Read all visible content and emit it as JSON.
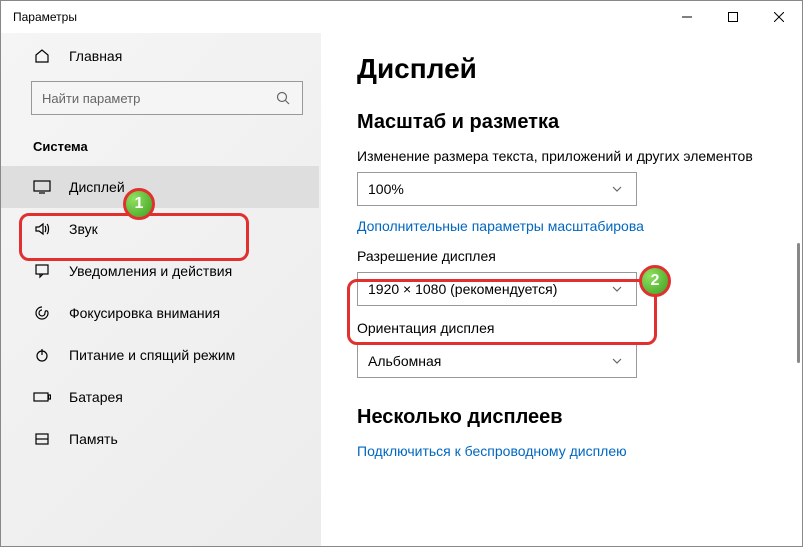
{
  "titlebar": {
    "title": "Параметры"
  },
  "sidebar": {
    "home": "Главная",
    "search_placeholder": "Найти параметр",
    "category": "Система",
    "items": [
      {
        "label": "Дисплей"
      },
      {
        "label": "Звук"
      },
      {
        "label": "Уведомления и действия"
      },
      {
        "label": "Фокусировка внимания"
      },
      {
        "label": "Питание и спящий режим"
      },
      {
        "label": "Батарея"
      },
      {
        "label": "Память"
      }
    ]
  },
  "content": {
    "heading": "Дисплей",
    "section_scale": "Масштаб и разметка",
    "label_text_size": "Изменение размера текста, приложений и других элементов",
    "scale_value": "100%",
    "advanced_scaling_link": "Дополнительные параметры масштабирова",
    "label_resolution": "Разрешение дисплея",
    "resolution_value": "1920 × 1080 (рекомендуется)",
    "label_orientation": "Ориентация дисплея",
    "orientation_value": "Альбомная",
    "section_multi": "Несколько дисплеев",
    "wireless_link": "Подключиться к беспроводному дисплею"
  },
  "annotations": {
    "step1": "1",
    "step2": "2"
  }
}
